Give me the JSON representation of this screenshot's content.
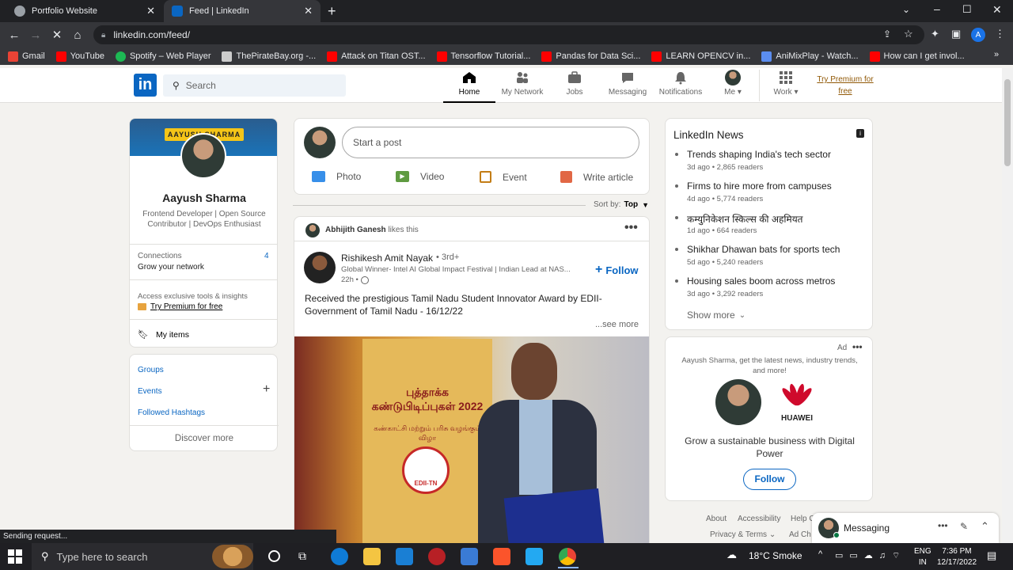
{
  "browser": {
    "tabs": [
      {
        "title": "Portfolio Website"
      },
      {
        "title": "Feed | LinkedIn"
      }
    ],
    "url": "linkedin.com/feed/",
    "bookmarks": [
      "Gmail",
      "YouTube",
      "Spotify – Web Player",
      "ThePirateBay.org -...",
      "Attack on Titan OST...",
      "Tensorflow Tutorial...",
      "Pandas for Data Sci...",
      "LEARN OPENCV in...",
      "AniMixPlay - Watch...",
      "How can I get invol..."
    ],
    "bookmark_more": "»",
    "status": "Sending request..."
  },
  "nav": {
    "logo": "in",
    "search_placeholder": "Search",
    "home": "Home",
    "network": "My Network",
    "jobs": "Jobs",
    "messaging": "Messaging",
    "notifications": "Notifications",
    "me": "Me",
    "work": "Work",
    "premium": "Try Premium for free"
  },
  "profile": {
    "banner_text": "AAYUSH SHARMA",
    "name": "Aayush Sharma",
    "headline": "Frontend Developer | Open Source Contributor | DevOps Enthusiast",
    "connections_label": "Connections",
    "connections_count": "4",
    "grow": "Grow your network",
    "premium_note": "Access exclusive tools & insights",
    "premium_link": "Try Premium for free",
    "my_items": "My items"
  },
  "left_links": {
    "groups": "Groups",
    "events": "Events",
    "hashtags": "Followed Hashtags",
    "discover": "Discover more"
  },
  "share": {
    "placeholder": "Start a post",
    "photo": "Photo",
    "video": "Video",
    "event": "Event",
    "article": "Write article"
  },
  "sort": {
    "label": "Sort by:",
    "value": "Top"
  },
  "post": {
    "liker": "Abhijith Ganesh",
    "likes_this": "likes this",
    "author": "Rishikesh Amit Nayak",
    "degree": "• 3rd+",
    "author_headline": "Global Winner- Intel AI Global Impact Festival | Indian Lead at NAS...",
    "time": "22h •",
    "follow": "Follow",
    "text": "Received the prestigious Tamil Nadu Student Innovator Award by EDII-Government of Tamil Nadu - 16/12/22",
    "see_more": "...see more",
    "image_poster_title": "புத்தாக்க கண்டுபிடிப்புகள் 2022",
    "image_poster_sub": "கண்காட்சி மற்றும் பரிசு வழங்கும் விழா",
    "image_logo": "EDII-TN"
  },
  "news": {
    "title": "LinkedIn News",
    "items": [
      {
        "headline": "Trends shaping India's tech sector",
        "meta": "3d ago • 2,865 readers"
      },
      {
        "headline": "Firms to hire more from campuses",
        "meta": "4d ago • 5,774 readers"
      },
      {
        "headline": "कम्युनिकेशन स्किल्स की अहमियत",
        "meta": "1d ago • 664 readers"
      },
      {
        "headline": "Shikhar Dhawan bats for sports tech",
        "meta": "5d ago • 5,240 readers"
      },
      {
        "headline": "Housing sales boom across metros",
        "meta": "3d ago • 3,292 readers"
      }
    ],
    "show_more": "Show more"
  },
  "ad": {
    "label": "Ad",
    "message": "Aayush Sharma, get the latest news, industry trends, and more!",
    "brand": "HUAWEI",
    "tagline": "Grow a sustainable business with Digital Power",
    "follow": "Follow"
  },
  "footer": {
    "about": "About",
    "accessibility": "Accessibility",
    "help": "Help C",
    "privacy": "Privacy & Terms",
    "ad_choices": "Ad Ch"
  },
  "messaging": {
    "label": "Messaging"
  },
  "taskbar": {
    "search": "Type here to search",
    "weather": "18°C  Smoke",
    "lang1": "ENG",
    "lang2": "IN",
    "time": "7:36 PM",
    "date": "12/17/2022"
  },
  "colors": {
    "linkedin_blue": "#0a66c2",
    "premium_gold": "#915907",
    "chrome_dark": "#202124"
  }
}
